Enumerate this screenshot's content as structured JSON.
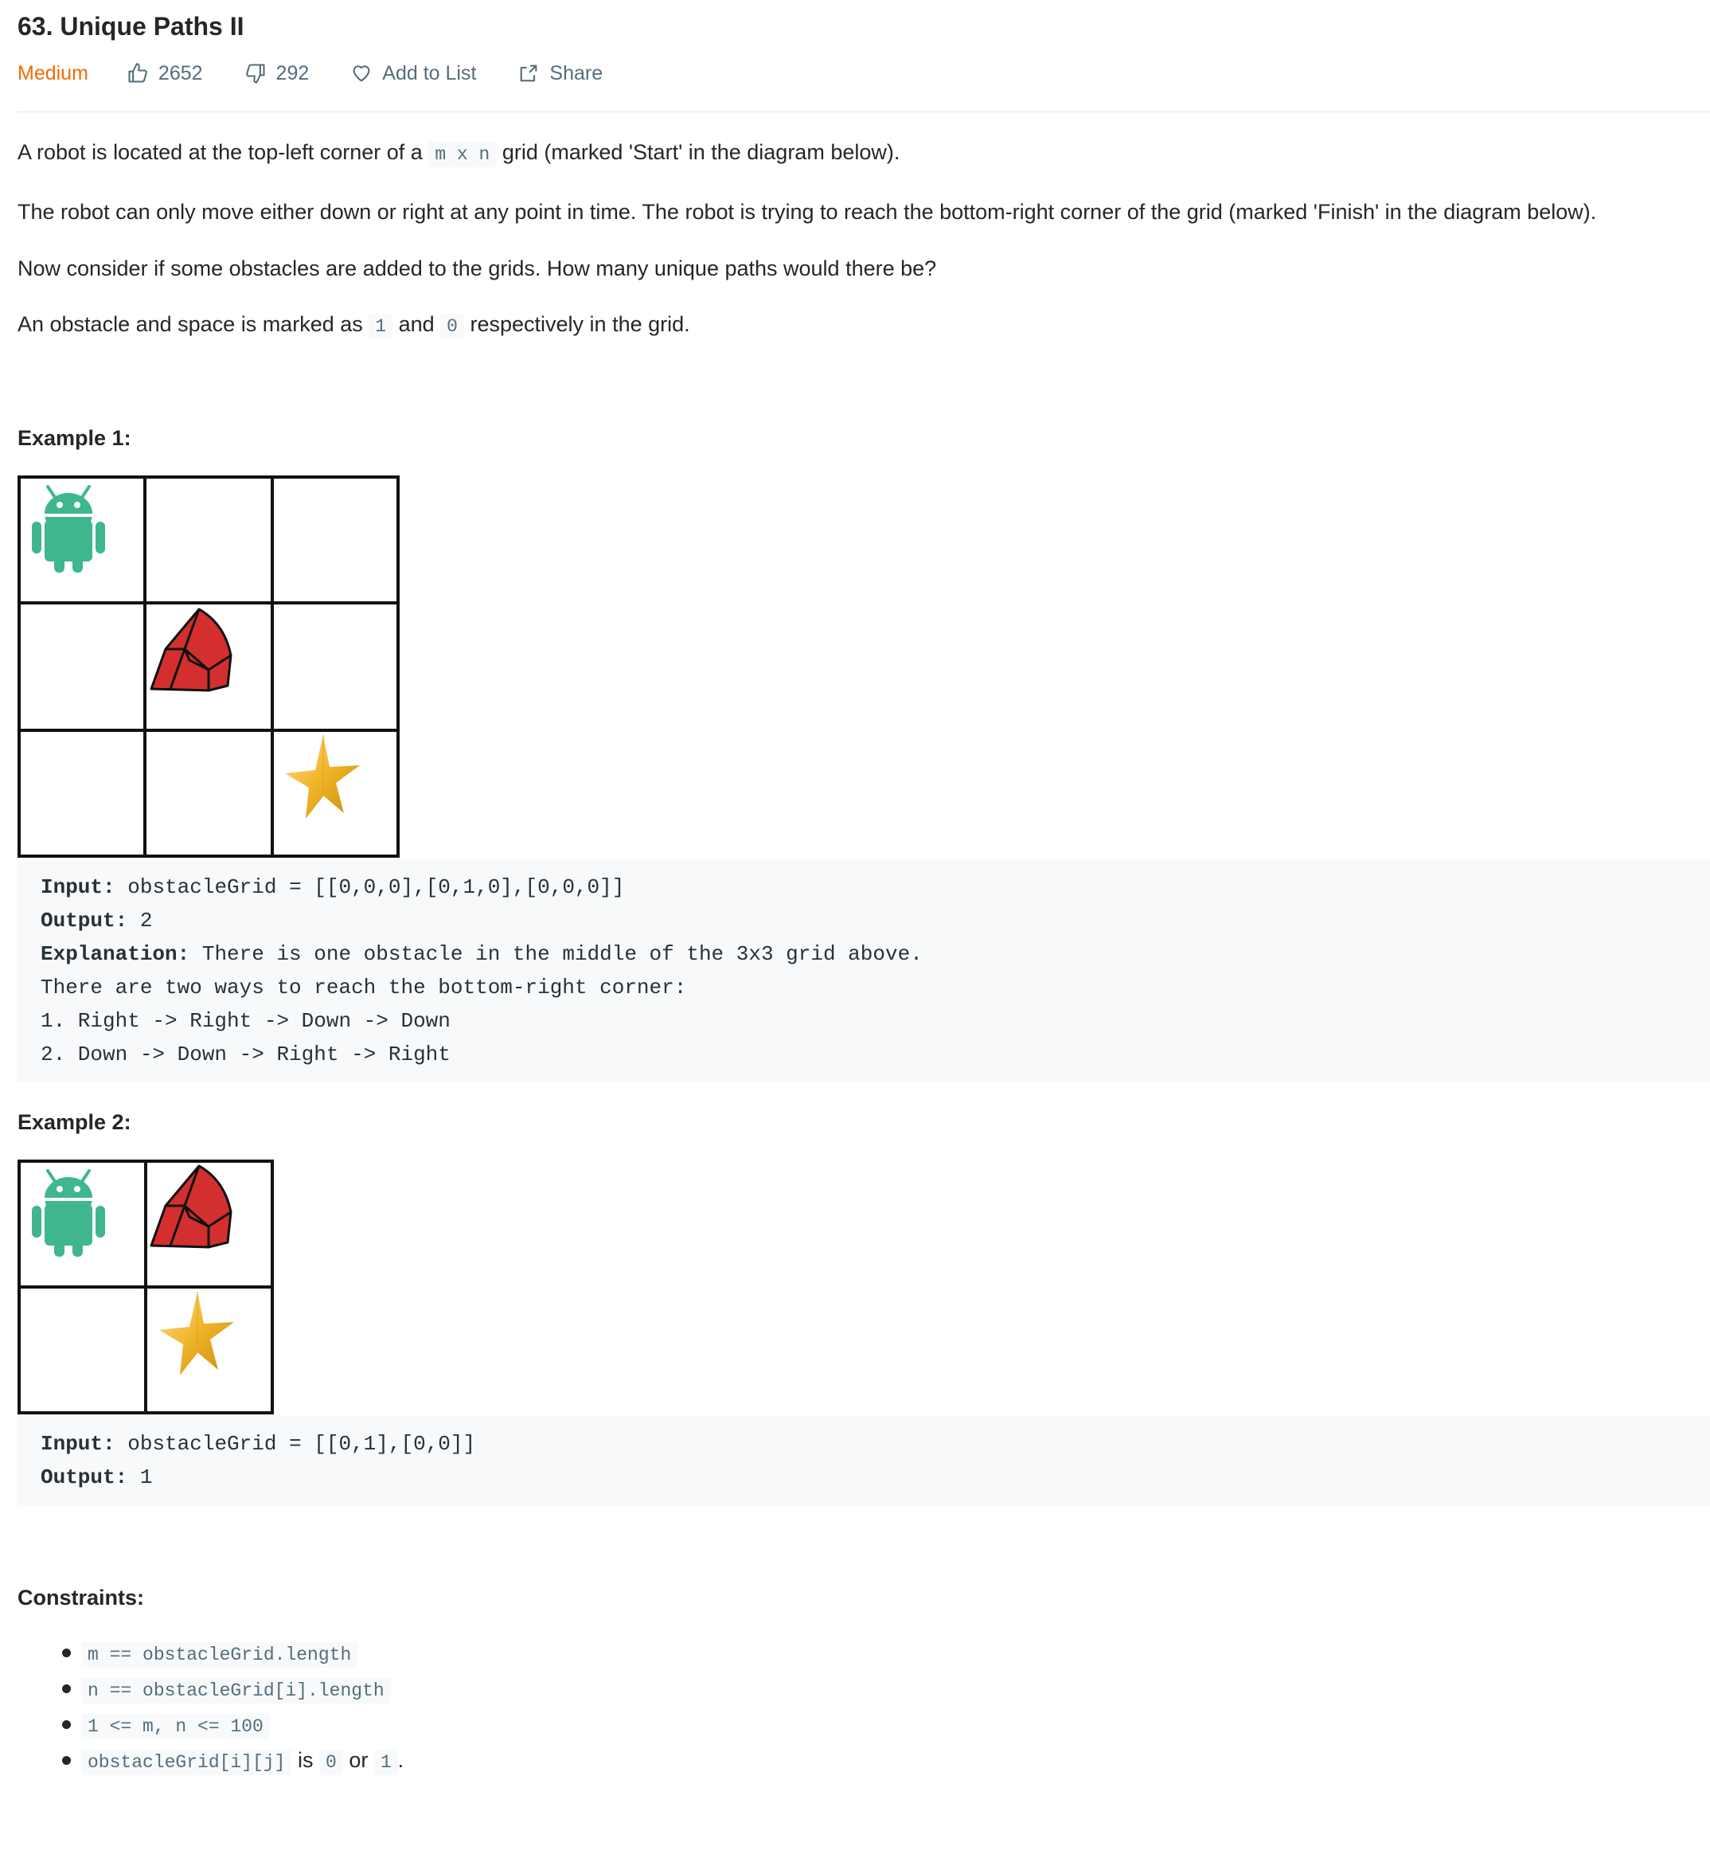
{
  "problem": {
    "title": "63. Unique Paths II",
    "difficulty": "Medium",
    "likes": "2652",
    "dislikes": "292",
    "add_to_list": "Add to List",
    "share": "Share"
  },
  "description": {
    "p1_pre": "A robot is located at the top-left corner of a",
    "p1_code": "m x n",
    "p1_post": "grid (marked 'Start' in the diagram below).",
    "p2": "The robot can only move either down or right at any point in time. The robot is trying to reach the bottom-right corner of the grid (marked 'Finish' in the diagram below).",
    "p3": "Now consider if some obstacles are added to the grids. How many unique paths would there be?",
    "p4_pre": "An obstacle and space is marked as",
    "p4_code1": "1",
    "p4_mid": "and",
    "p4_code2": "0",
    "p4_post": "respectively in the grid."
  },
  "example1": {
    "heading": "Example 1:",
    "input_label": "Input:",
    "input_value": "obstacleGrid = [[0,0,0],[0,1,0],[0,0,0]]",
    "output_label": "Output:",
    "output_value": "2",
    "explanation_label": "Explanation:",
    "explanation_value": "There is one obstacle in the middle of the 3x3 grid above.",
    "line4": "There are two ways to reach the bottom-right corner:",
    "line5": "1. Right -> Right -> Down -> Down",
    "line6": "2. Down -> Down -> Right -> Right"
  },
  "example2": {
    "heading": "Example 2:",
    "input_label": "Input:",
    "input_value": "obstacleGrid = [[0,1],[0,0]]",
    "output_label": "Output:",
    "output_value": "1"
  },
  "constraints": {
    "heading": "Constraints:",
    "c1": "m == obstacleGrid.length",
    "c2": "n == obstacleGrid[i].length",
    "c3": "1 <= m, n <= 100",
    "c4_code": "obstacleGrid[i][j]",
    "c4_is": "is",
    "c4_v0": "0",
    "c4_or": "or",
    "c4_v1": "1",
    "c4_dot": "."
  },
  "colors": {
    "difficulty": "#ef6c00",
    "robot": "#3fb68e",
    "obstacle": "#d32f2f",
    "star": "#f0b429"
  }
}
